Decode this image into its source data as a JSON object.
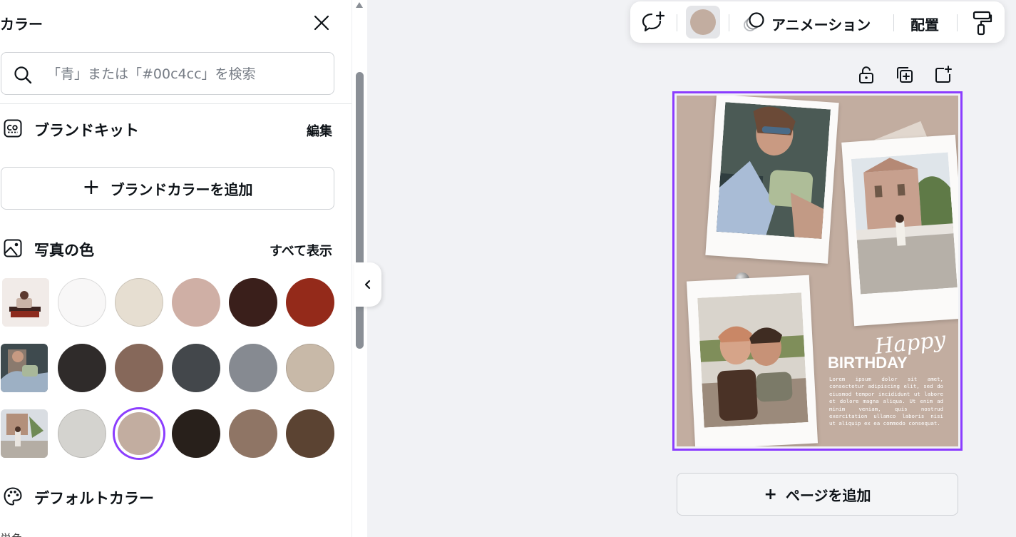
{
  "panel": {
    "title": "カラー",
    "search_placeholder": "「青」または「#00c4cc」を検索",
    "brand_kit": {
      "title": "ブランドキット",
      "edit_label": "編集",
      "add_button_label": "ブランドカラーを追加"
    },
    "photo_colors": {
      "title": "写真の色",
      "show_all_label": "すべて表示",
      "rows": [
        {
          "thumb": "photo-thumb-1",
          "swatches": [
            "#f8f7f7",
            "#e6ded1",
            "#cfafa5",
            "#3a1f1b",
            "#942a1a"
          ]
        },
        {
          "thumb": "photo-thumb-2",
          "swatches": [
            "#2f2b2a",
            "#86685a",
            "#43474b",
            "#868a91",
            "#c8b9a8"
          ]
        },
        {
          "thumb": "photo-thumb-3",
          "swatches": [
            "#d4d3cf",
            "#c2ada0",
            "#28201b",
            "#8f7565",
            "#5b4332"
          ]
        }
      ],
      "selected": "#c2ada0"
    },
    "default_colors": {
      "title": "デフォルトカラー",
      "subtitle": "単色"
    }
  },
  "toolbar": {
    "current_color": "#c2ada0",
    "animation_label": "アニメーション",
    "position_label": "配置"
  },
  "canvas": {
    "background": "#c2ada0",
    "happy_text": "Happy",
    "birthday_text": "BIRTHDAY",
    "body_text": "Lorem ipsum dolor sit amet, consectetur adipiscing elit, sed do eiusmod tempor incididunt ut labore et dolore magna aliqua. Ut enim ad minim veniam, quis nostrud exercitation ullamco laboris nisi ut aliquip ex ea commodo consequat."
  },
  "add_page_label": "ページを追加",
  "colors": {
    "accent": "#8b3dff"
  }
}
